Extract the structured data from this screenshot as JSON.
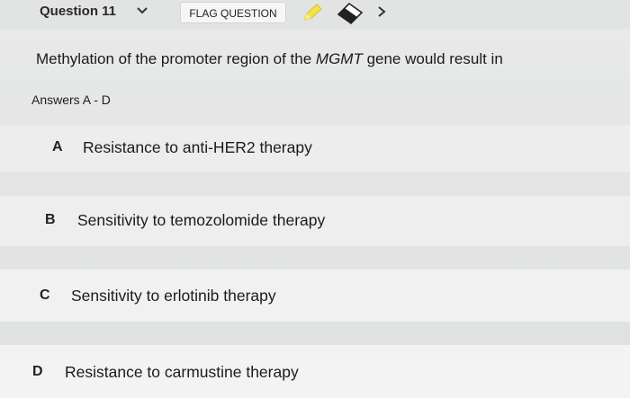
{
  "header": {
    "question_number": "Question 11",
    "flag_label": "FLAG QUESTION",
    "icons": {
      "dropdown": "chevron-down-icon",
      "highlighter": "pencil-icon",
      "eraser": "eraser-icon",
      "next": "chevron-right-icon"
    },
    "colors": {
      "highlighter": "#f4e24a"
    }
  },
  "question": {
    "text_before": "Methylation of the promoter region of the ",
    "gene": "MGMT",
    "text_after": " gene would result in"
  },
  "answers_label": "Answers A - D",
  "options": [
    {
      "letter": "A",
      "text": "Resistance to anti-HER2 therapy"
    },
    {
      "letter": "B",
      "text": "Sensitivity to temozolomide therapy"
    },
    {
      "letter": "C",
      "text": "Sensitivity to erlotinib therapy"
    },
    {
      "letter": "D",
      "text": "Resistance to carmustine therapy"
    }
  ]
}
